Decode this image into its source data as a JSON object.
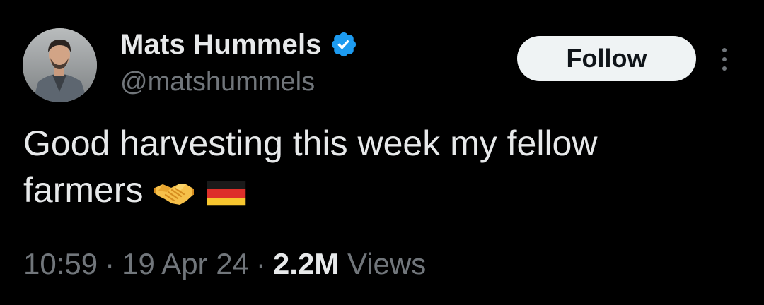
{
  "tweet": {
    "author": {
      "display_name": "Mats Hummels",
      "handle": "@matshummels",
      "verified_icon": "verified-badge-icon",
      "avatar": "avatar-photo"
    },
    "follow_label": "Follow",
    "more_icon": "more-options-icon",
    "text_line1": "Good harvesting this week my fellow",
    "text_line2": "farmers",
    "emojis": [
      "handshake-emoji",
      "germany-flag-emoji"
    ],
    "time": "10:59",
    "separator": "·",
    "date": "19 Apr 24",
    "views_count": "2.2M",
    "views_label": "Views"
  },
  "colors": {
    "background": "#000000",
    "text_primary": "#e7e9ea",
    "text_secondary": "#71767b",
    "verified_blue": "#1d9bf0",
    "follow_bg": "#eff3f4"
  }
}
